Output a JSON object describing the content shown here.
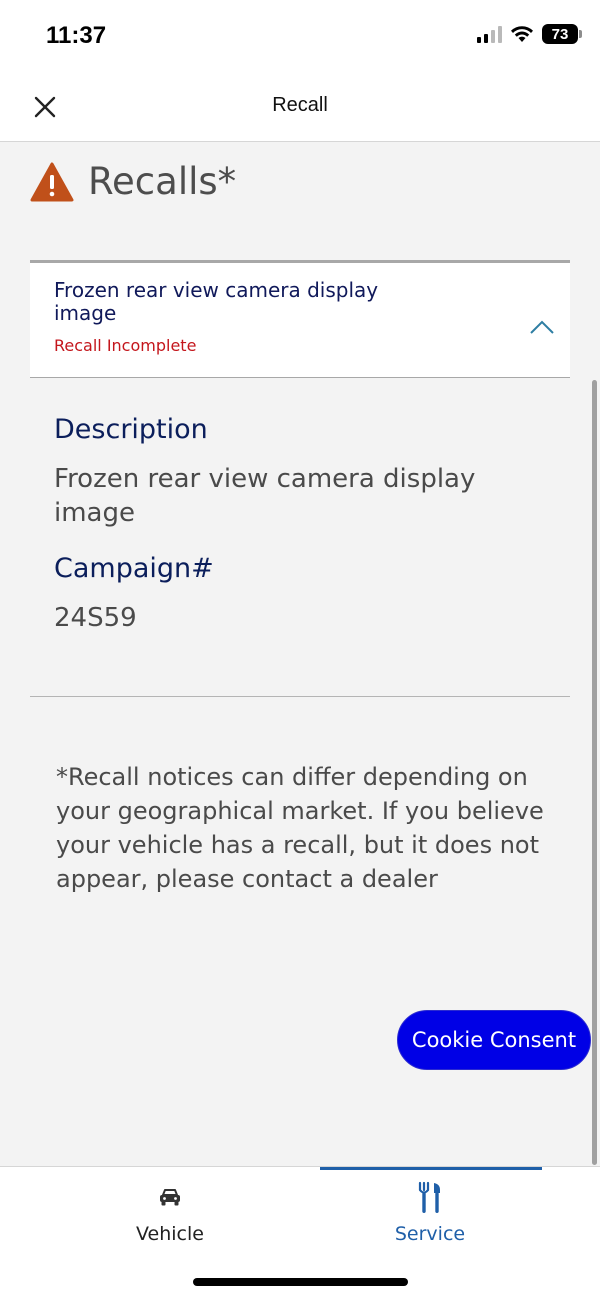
{
  "status_bar": {
    "time": "11:37",
    "battery": "73"
  },
  "header": {
    "title": "Recall",
    "close_icon": "close-icon"
  },
  "recalls": {
    "title": "Recalls*",
    "icon": "warning-triangle-icon",
    "icon_color": "#c0501a",
    "item": {
      "name": "Frozen rear view camera display image",
      "status": "Recall Incomplete",
      "status_color": "#c4161c",
      "expanded": true
    },
    "details": {
      "description_label": "Description",
      "description_value": "Frozen rear view camera display image",
      "campaign_label": "Campaign#",
      "campaign_value": "24S59"
    }
  },
  "disclaimer": "*Recall notices can differ depending on your geographical market. If you believe your vehicle has a recall, but it does not appear, please contact a dealer",
  "cookie_consent": {
    "label": "Cookie Consent",
    "color": "#0000e6"
  },
  "tabbar": {
    "tabs": [
      {
        "label": "Vehicle",
        "icon": "car-icon",
        "active": false
      },
      {
        "label": "Service",
        "icon": "tools-icon",
        "active": true
      }
    ],
    "accent": "#1f5fa8"
  }
}
